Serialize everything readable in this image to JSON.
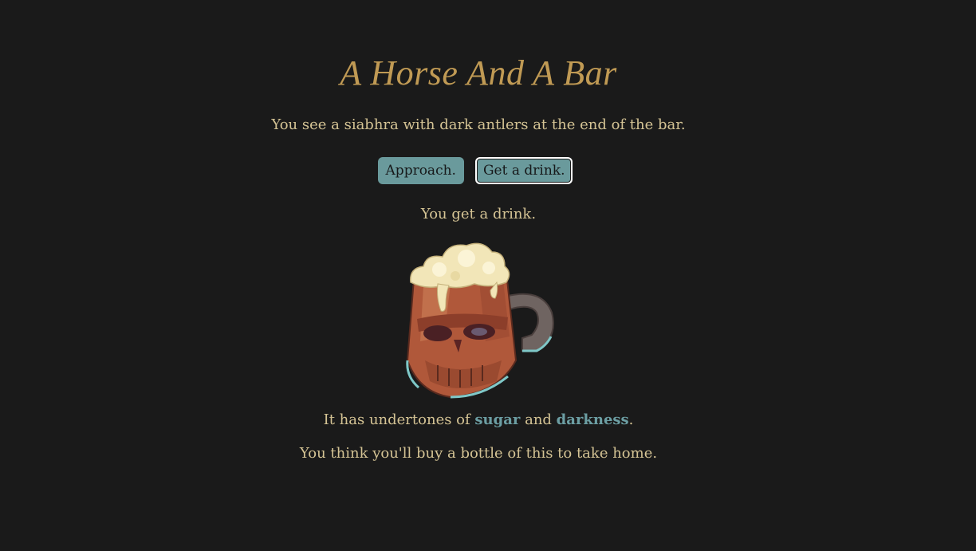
{
  "title": "A Horse And A Bar",
  "intro": "You see a siabhra with dark antlers at the end of the bar.",
  "choices": {
    "approach_label": "Approach.",
    "drink_label": "Get a drink.",
    "selected": "Get a drink."
  },
  "result": "You get a drink.",
  "drink_image": {
    "icon": "skull-tankard-icon"
  },
  "flavor": {
    "prefix": "It has undertones of ",
    "note1": "sugar",
    "middle": " and ",
    "note2": "darkness",
    "suffix": "."
  },
  "closing": "You think you'll buy a bottle of this to take home.",
  "colors": {
    "background": "#1a1a1a",
    "title": "#c09a54",
    "text": "#d4c394",
    "keyword": "#6c9ea3",
    "button": "#6a9a9c"
  }
}
